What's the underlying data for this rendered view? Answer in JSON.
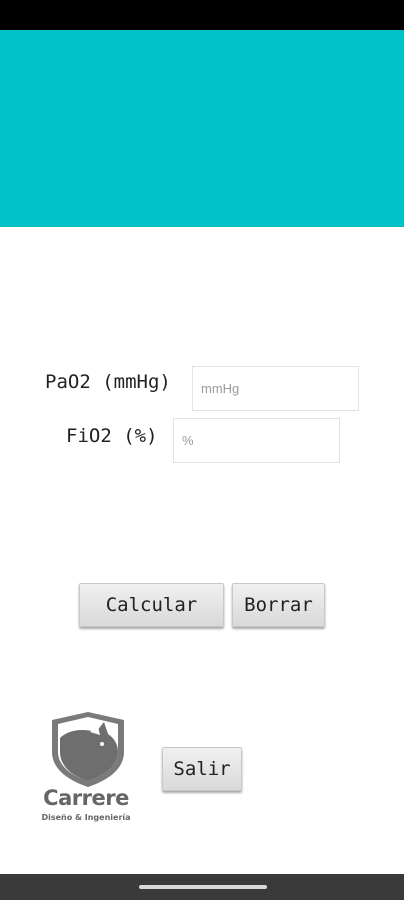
{
  "colors": {
    "header": "#00c2c6",
    "status_bar": "#000000",
    "nav_bar": "#3a3a3a"
  },
  "form": {
    "pao2_label": "PaO2 (mmHg)",
    "pao2_placeholder": "mmHg",
    "pao2_value": "",
    "fio2_label": "FiO2 (%)",
    "fio2_placeholder": "%",
    "fio2_value": ""
  },
  "buttons": {
    "calculate": "Calcular",
    "clear": "Borrar",
    "exit": "Salir"
  },
  "logo": {
    "name": "Carrere",
    "tagline": "Diseño & Ingeniería"
  }
}
